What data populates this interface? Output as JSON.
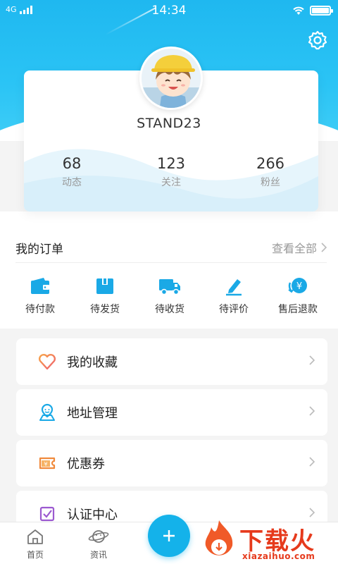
{
  "status_bar": {
    "network": "4G",
    "time": "14:34"
  },
  "profile": {
    "username": "STAND23",
    "stats": [
      {
        "value": "68",
        "label": "动态"
      },
      {
        "value": "123",
        "label": "关注"
      },
      {
        "value": "266",
        "label": "粉丝"
      }
    ]
  },
  "orders": {
    "title": "我的订单",
    "view_all": "查看全部",
    "items": [
      {
        "label": "待付款",
        "icon": "wallet-icon"
      },
      {
        "label": "待发货",
        "icon": "box-icon"
      },
      {
        "label": "待收货",
        "icon": "truck-icon"
      },
      {
        "label": "待评价",
        "icon": "pen-icon"
      },
      {
        "label": "售后退款",
        "icon": "refund-icon"
      }
    ]
  },
  "menu": [
    {
      "label": "我的收藏",
      "icon": "heart-icon"
    },
    {
      "label": "地址管理",
      "icon": "location-icon"
    },
    {
      "label": "优惠券",
      "icon": "coupon-icon"
    },
    {
      "label": "认证中心",
      "icon": "check-icon"
    }
  ],
  "bottom_nav": {
    "home": "首页",
    "news": "资讯"
  },
  "watermark": {
    "text": "下载火",
    "url": "xiazaihuo.com"
  },
  "colors": {
    "accent": "#14b2ea",
    "header": "#22bdf2",
    "order_icon": "#1aa9e6"
  }
}
